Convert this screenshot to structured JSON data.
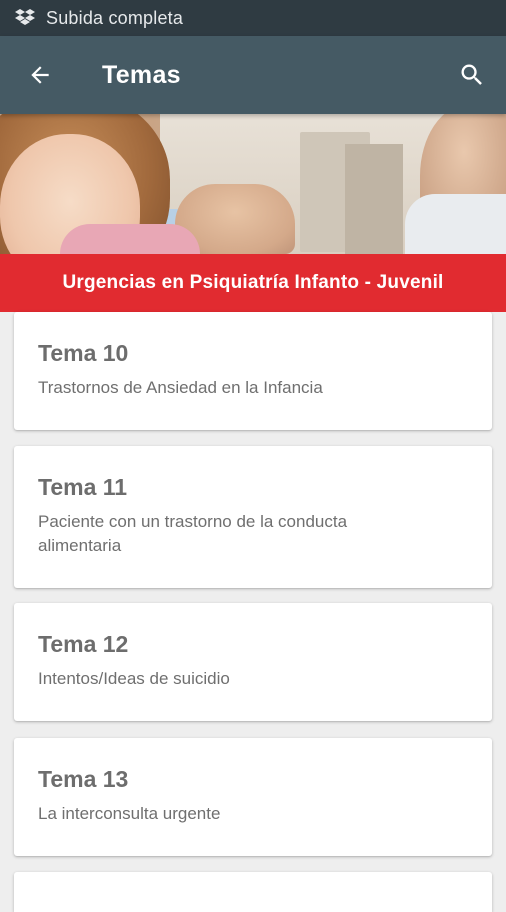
{
  "status_bar": {
    "icon": "dropbox-icon",
    "text": "Subida completa"
  },
  "app_bar": {
    "back_icon": "arrow-back-icon",
    "title": "Temas",
    "search_icon": "search-icon",
    "color": "#455a64"
  },
  "banner": {
    "text": "Urgencias en Psiquiatría Infanto - Juvenil",
    "color": "#e12b30"
  },
  "topics": [
    {
      "title": "Tema 10",
      "subtitle": "Trastornos de Ansiedad en la Infancia"
    },
    {
      "title": "Tema 11",
      "subtitle": "Paciente con un trastorno de la conducta alimentaria"
    },
    {
      "title": "Tema 12",
      "subtitle": "Intentos/Ideas de suicidio"
    },
    {
      "title": "Tema 13",
      "subtitle": "La interconsulta urgente"
    }
  ]
}
